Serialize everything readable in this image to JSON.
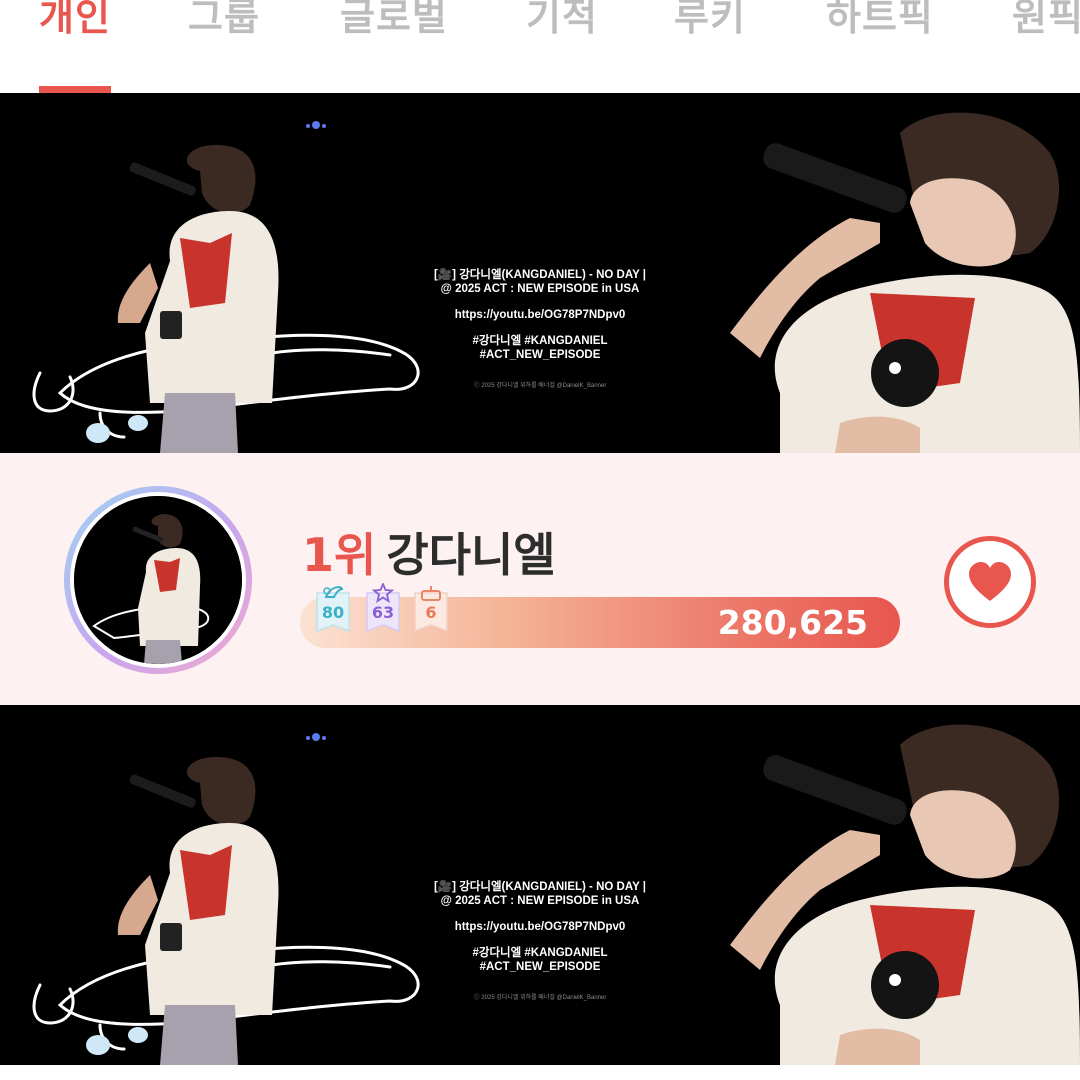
{
  "tabs": [
    {
      "label": "개인",
      "active": true
    },
    {
      "label": "그룹",
      "active": false
    },
    {
      "label": "글로벌",
      "active": false
    },
    {
      "label": "기적",
      "active": false
    },
    {
      "label": "루키",
      "active": false
    },
    {
      "label": "하트픽",
      "active": false
    },
    {
      "label": "원픽",
      "active": false
    }
  ],
  "banner": {
    "line1": "[🎥] 강다니엘(KANGDANIEL) - NO DAY |",
    "line2": "@ 2025 ACT : NEW EPISODE in USA",
    "url": "https://youtu.be/OG78P7NDpv0",
    "tags1": "#강다니엘 #KANGDANIEL",
    "tags2": "#ACT_NEW_EPISODE",
    "credit": "ⓒ 2025 강다니엘 위하를 배너걸 @DanielK_Banner"
  },
  "ranking": {
    "rank": "1위",
    "name": "강다니엘",
    "score": "280,625",
    "badges": [
      {
        "icon": "angel-wing-icon",
        "value": "80",
        "color": "#3ab0c8"
      },
      {
        "icon": "star-icon",
        "value": "63",
        "color": "#8c5fd6"
      },
      {
        "icon": "cake-icon",
        "value": "6",
        "color": "#e87a5a"
      }
    ]
  },
  "colors": {
    "accent": "#e8564e",
    "inactive_tab": "#bdbdbd",
    "card_background": "#fdf2f1"
  }
}
